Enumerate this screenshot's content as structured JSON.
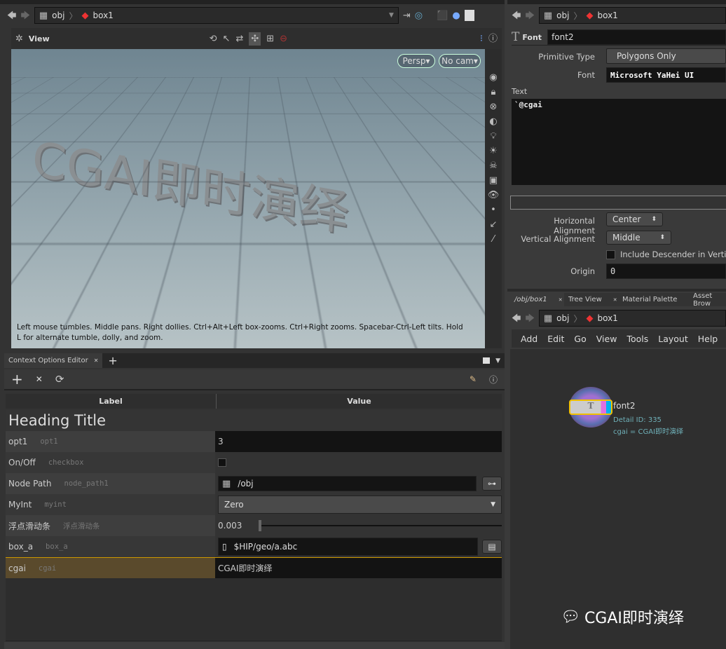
{
  "left_nav": {
    "path": [
      "obj",
      "box1"
    ]
  },
  "viewport": {
    "title": "View",
    "persp": "Persp",
    "cam": "No cam",
    "overlay_text": "CGAI即时演绎",
    "hint": "Left mouse tumbles. Middle pans. Right dollies. Ctrl+Alt+Left box-zooms. Ctrl+Right zooms. Spacebar-Ctrl-Left tilts. Hold L for alternate tumble, dolly, and zoom."
  },
  "context_editor": {
    "tab": "Context Options Editor",
    "col_label": "Label",
    "col_value": "Value",
    "heading": "Heading Title",
    "rows": [
      {
        "label": "opt1",
        "name": "opt1",
        "value": "3"
      },
      {
        "label": "On/Off",
        "name": "checkbox",
        "value": ""
      },
      {
        "label": "Node Path",
        "name": "node_path1",
        "value": "/obj"
      },
      {
        "label": "MyInt",
        "name": "myint",
        "value": "Zero"
      },
      {
        "label": "浮点滑动条",
        "name": "浮点滑动条",
        "value": "0.003"
      },
      {
        "label": "box_a",
        "name": "box_a",
        "value": "$HIP/geo/a.abc"
      },
      {
        "label": "cgai",
        "name": "cgai",
        "value": "CGAI即时演绎"
      }
    ]
  },
  "params": {
    "path": [
      "obj",
      "box1"
    ],
    "node_type": "Font",
    "node_name": "font2",
    "primitive_type_label": "Primitive Type",
    "primitive_type": "Polygons Only",
    "font_label": "Font",
    "font": "Microsoft YaHei UI",
    "text_label": "Text",
    "text": "`@cgai",
    "halign_label": "Horizontal Alignment",
    "halign": "Center",
    "valign_label": "Vertical Alignment",
    "valign": "Middle",
    "descender_label": "Include Descender in Vertical A",
    "origin_label": "Origin",
    "origin": "0"
  },
  "network": {
    "tabs": [
      "/obj/box1",
      "Tree View",
      "Material Palette",
      "Asset Brow"
    ],
    "path": [
      "obj",
      "box1"
    ],
    "menu": [
      "Add",
      "Edit",
      "Go",
      "View",
      "Tools",
      "Layout",
      "Help"
    ],
    "node": {
      "name": "font2",
      "detail": "Detail ID: 335",
      "attr": "cgai = CGAI即时演绎"
    }
  },
  "watermark": "CGAI即时演绎",
  "colors": {
    "accent": "#f0c000",
    "info": "#6fb0b8",
    "selected_row": "#5a4a2c"
  }
}
